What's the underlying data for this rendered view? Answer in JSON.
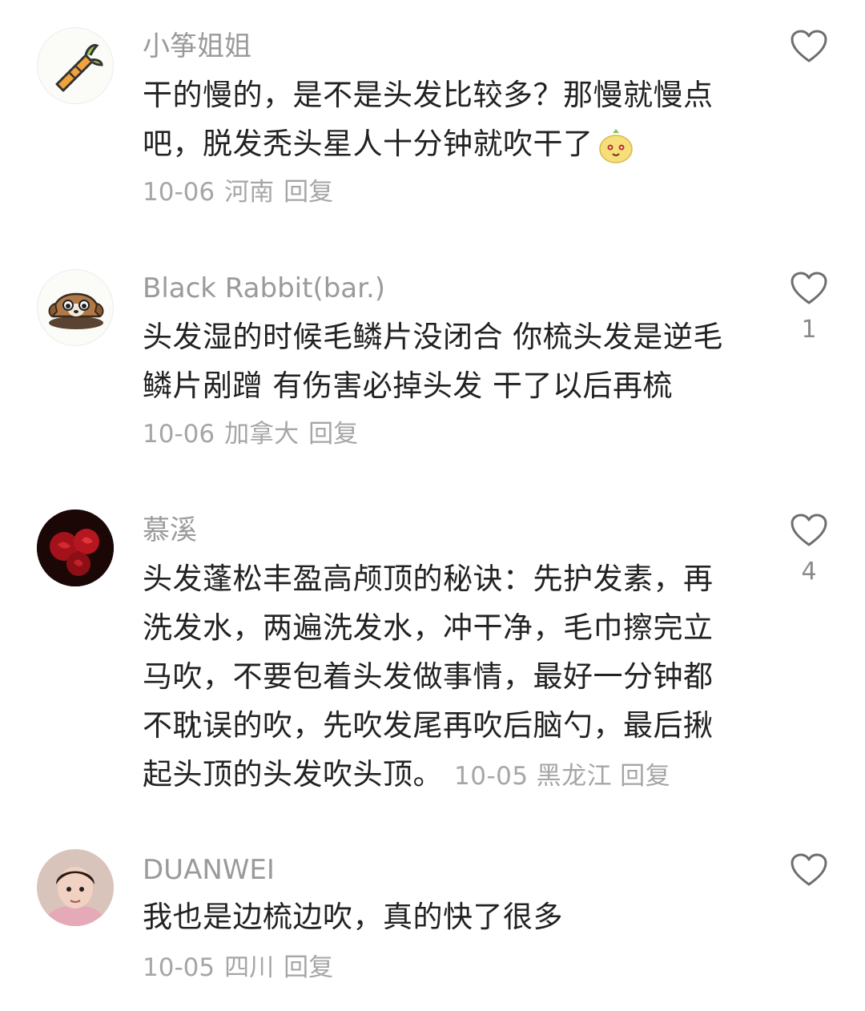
{
  "comments": [
    {
      "username": "小筝姐姐",
      "text": "干的慢的，是不是头发比较多？那慢就慢点吧，脱发秃头星人十分钟就吹干了",
      "date": "10-06",
      "location": "河南",
      "reply": "回复",
      "likes": "",
      "avatar_icon": "carrot-icon",
      "emoji_icon": "smiling-face-emoji"
    },
    {
      "username": "Black Rabbit(bar.)",
      "text": "头发湿的时候毛鳞片没闭合 你梳头发是逆毛鳞片剐蹭  有伤害必掉头发 干了以后再梳",
      "date": "10-06",
      "location": "加拿大",
      "reply": "回复",
      "likes": "1",
      "avatar_icon": "dog-icon"
    },
    {
      "username": "慕溪",
      "text": "头发蓬松丰盈高颅顶的秘诀：先护发素，再洗发水，两遍洗发水，冲干净，毛巾擦完立马吹，不要包着头发做事情，最好一分钟都不耽误的吹，先吹发尾再吹后脑勺，最后揪起头顶的头发吹头顶。",
      "date": "10-05",
      "location": "黑龙江",
      "reply": "回复",
      "likes": "4",
      "avatar_icon": "rose-photo"
    },
    {
      "username": "DUANWEI",
      "text": "我也是边梳边吹，真的快了很多",
      "date": "10-05",
      "location": "四川",
      "reply": "回复",
      "likes": "",
      "avatar_icon": "child-photo"
    }
  ],
  "colors": {
    "username": "#9a9a9a",
    "text": "#222222",
    "meta": "#a6a6a6",
    "like_icon": "#6e6e6e"
  }
}
